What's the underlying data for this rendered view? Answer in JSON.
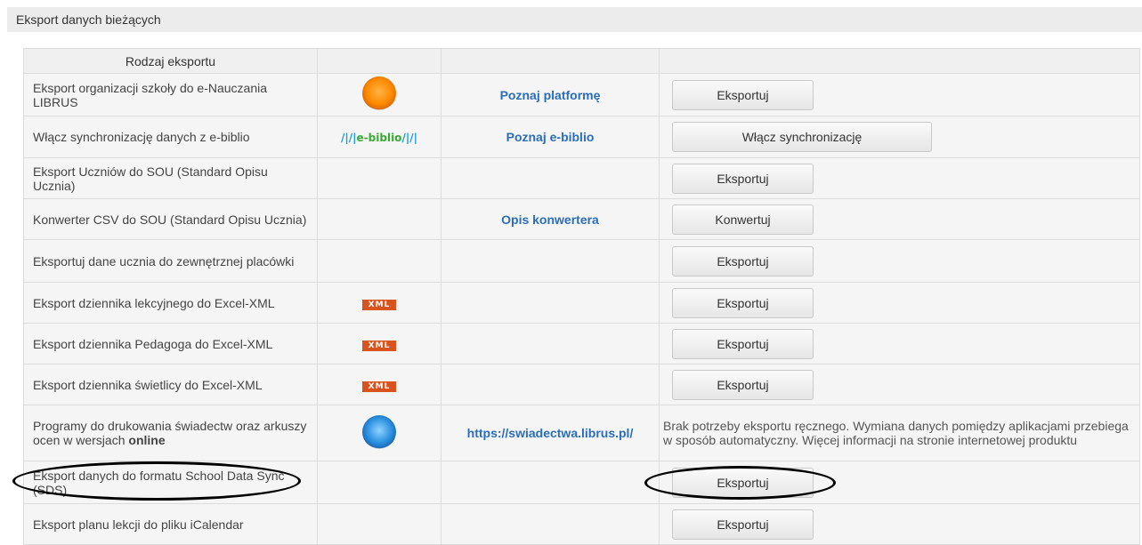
{
  "section_title": "Eksport danych bieżących",
  "table": {
    "header": "Rodzaj eksportu",
    "rows": [
      {
        "label": "Eksport organizacji szkoły do e-Nauczania LIBRUS",
        "icon": "orange-orb-icon",
        "link": "Poznaj platformę",
        "button": "Eksportuj"
      },
      {
        "label": "Włącz synchronizację danych z e-biblio",
        "icon": "e-biblio-logo",
        "logo_text": "e-biblio",
        "link": "Poznaj e-biblio",
        "button": "Włącz synchronizację"
      },
      {
        "label": "Eksport Uczniów do SOU (Standard Opisu Ucznia)",
        "button": "Eksportuj"
      },
      {
        "label": "Konwerter CSV do SOU (Standard Opisu Ucznia)",
        "link": "Opis konwertera",
        "button": "Konwertuj"
      },
      {
        "label": "Eksportuj dane ucznia do zewnętrznej placówki",
        "button": "Eksportuj"
      },
      {
        "label": "Eksport dziennika lekcyjnego do Excel-XML",
        "icon": "xml-badge",
        "badge": "XML",
        "button": "Eksportuj"
      },
      {
        "label": "Eksport dziennika Pedagoga do Excel-XML",
        "icon": "xml-badge",
        "badge": "XML",
        "button": "Eksportuj"
      },
      {
        "label": "Eksport dziennika świetlicy do Excel-XML",
        "icon": "xml-badge",
        "badge": "XML",
        "button": "Eksportuj"
      },
      {
        "label_main": "Programy do drukowania świadectw oraz arkuszy ocen w wersjach",
        "label_bold": "online",
        "icon": "blue-orb-icon",
        "link": "https://swiadectwa.librus.pl/",
        "note": "Brak potrzeby eksportu ręcznego. Wymiana danych pomiędzy aplikacjami przebiega w sposób automatyczny. Więcej informacji na stronie internetowej produktu"
      },
      {
        "label": "Eksport danych do formatu School Data Sync (SDS)",
        "button": "Eksportuj"
      },
      {
        "label": "Eksport planu lekcji do pliku iCalendar",
        "button": "Eksportuj"
      }
    ]
  },
  "annotations": {
    "color": "#000000",
    "description": "hand-drawn ellipses around SDS row label and button"
  }
}
